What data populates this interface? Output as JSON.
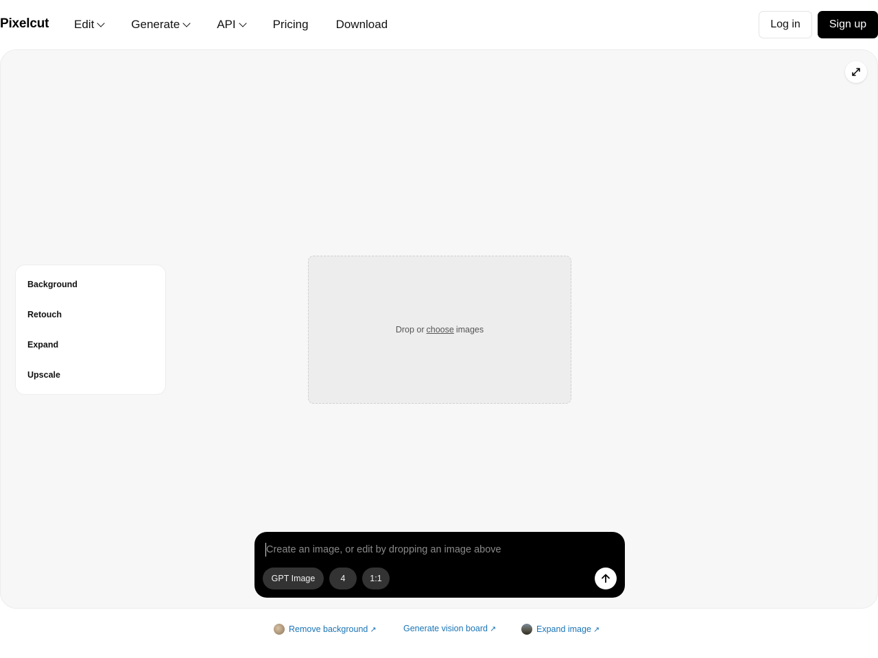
{
  "brand": {
    "name": "Pixelcut"
  },
  "nav": {
    "items": [
      {
        "label": "Edit",
        "has_dropdown": true
      },
      {
        "label": "Generate",
        "has_dropdown": true
      },
      {
        "label": "API",
        "has_dropdown": true
      },
      {
        "label": "Pricing",
        "has_dropdown": false
      },
      {
        "label": "Download",
        "has_dropdown": false
      }
    ],
    "login_label": "Log in",
    "signup_label": "Sign up"
  },
  "workspace": {
    "expand_icon": "expand-arrows-icon",
    "tools": [
      "Background",
      "Retouch",
      "Expand",
      "Upscale"
    ],
    "dropzone": {
      "prefix": "Drop or",
      "link": "choose",
      "suffix": "images"
    }
  },
  "prompt": {
    "placeholder": "Create an image, or edit by dropping an image above",
    "value": "",
    "model_chip": "GPT Image",
    "count_chip": "4",
    "ratio_chip": "1:1",
    "send_icon": "arrow-up-icon"
  },
  "footer": {
    "links": [
      {
        "label": "Remove background",
        "arrow": "↗",
        "has_thumb": true
      },
      {
        "label": "Generate vision board",
        "arrow": "↗",
        "has_thumb": false
      },
      {
        "label": "Expand image",
        "arrow": "↗",
        "has_thumb": true
      }
    ]
  },
  "colors": {
    "accent_link": "#1a74b5",
    "workspace_bg": "#f7f7f7",
    "prompt_bg": "#000000",
    "chip_bg": "#333333",
    "signup_bg": "#000000"
  }
}
